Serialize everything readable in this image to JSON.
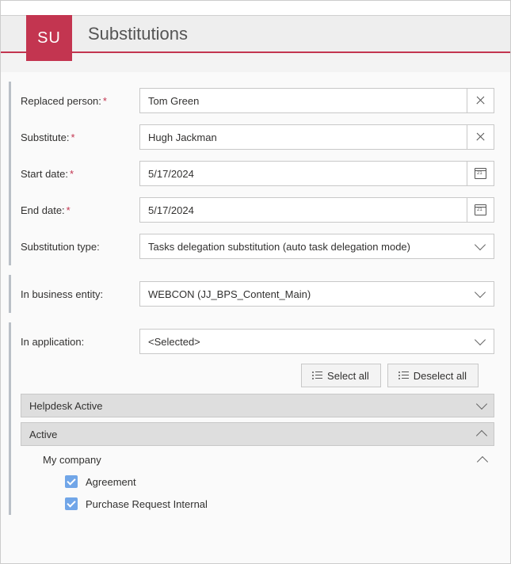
{
  "header": {
    "tile_text": "SU",
    "title": "Substitutions"
  },
  "form": {
    "labels": {
      "replaced_person": "Replaced person:",
      "substitute": "Substitute:",
      "start_date": "Start date:",
      "end_date": "End date:",
      "substitution_type": "Substitution type:",
      "business_entity": "In business entity:",
      "in_application": "In application:"
    },
    "values": {
      "replaced_person": "Tom Green",
      "substitute": "Hugh Jackman",
      "start_date": "5/17/2024",
      "end_date": "5/17/2024",
      "substitution_type": "Tasks delegation substitution (auto task delegation mode)",
      "business_entity": "WEBCON (JJ_BPS_Content_Main)",
      "in_application": "<Selected>"
    }
  },
  "buttons": {
    "select_all": "Select all",
    "deselect_all": "Deselect all"
  },
  "groups": {
    "helpdesk": "Helpdesk Active",
    "active": "Active",
    "my_company": "My company",
    "items": {
      "agreement": "Agreement",
      "purchase_request": "Purchase Request Internal"
    }
  }
}
